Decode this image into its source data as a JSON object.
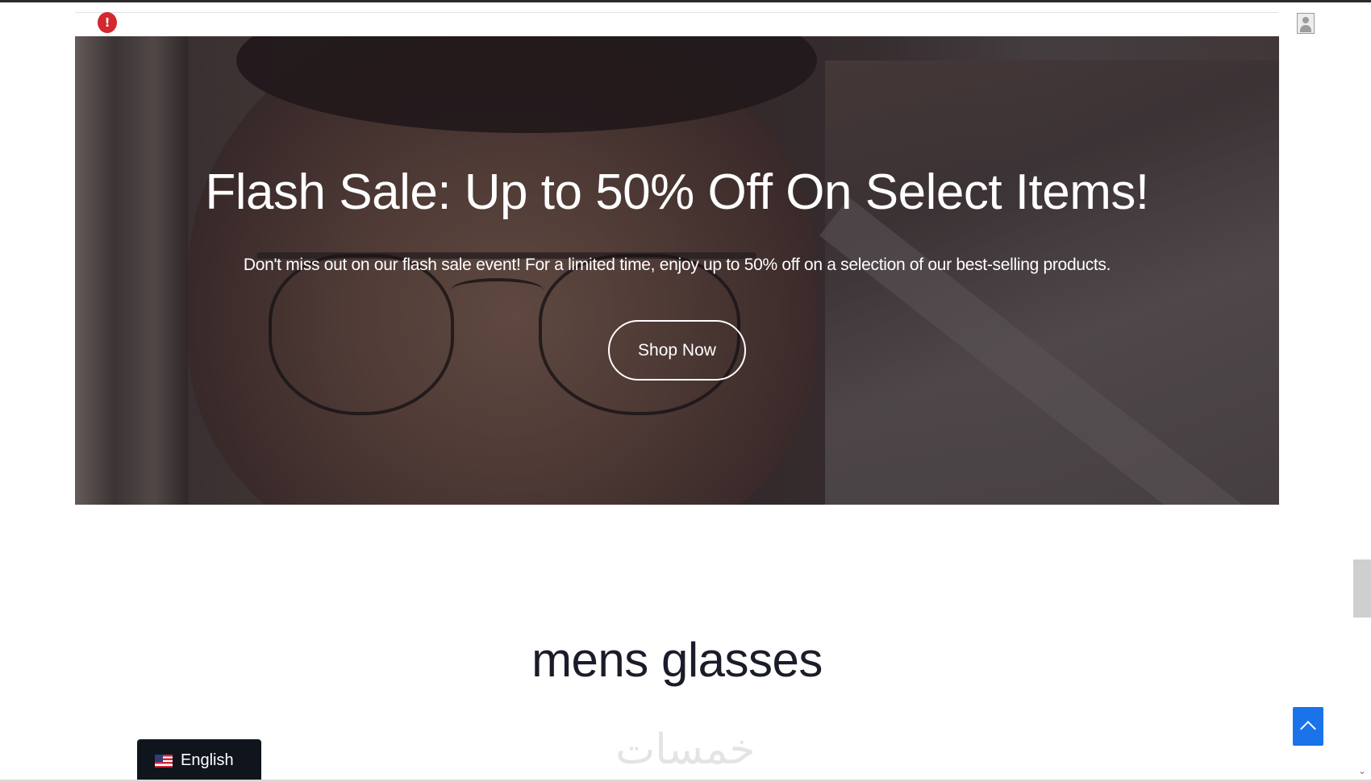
{
  "header": {
    "alert_icon": "alert-circle-icon",
    "alert_glyph": "!",
    "user_icon": "user-avatar-icon"
  },
  "hero": {
    "title": "Flash Sale: Up to 50% Off On Select Items!",
    "subtitle": "Don't miss out on our flash sale event! For a limited time, enjoy up to 50% off on a selection of our best-selling products.",
    "cta_label": "Shop Now"
  },
  "section": {
    "title": "mens glasses"
  },
  "language_switcher": {
    "label": "English",
    "flag_icon": "us-flag-icon"
  },
  "back_to_top": {
    "icon": "chevron-up-icon"
  },
  "watermark": {
    "text": "خمسات"
  },
  "colors": {
    "accent_blue": "#1a73e8",
    "alert_red": "#d3282f",
    "language_bg": "#10151d",
    "heading_text": "#1a1d29"
  }
}
